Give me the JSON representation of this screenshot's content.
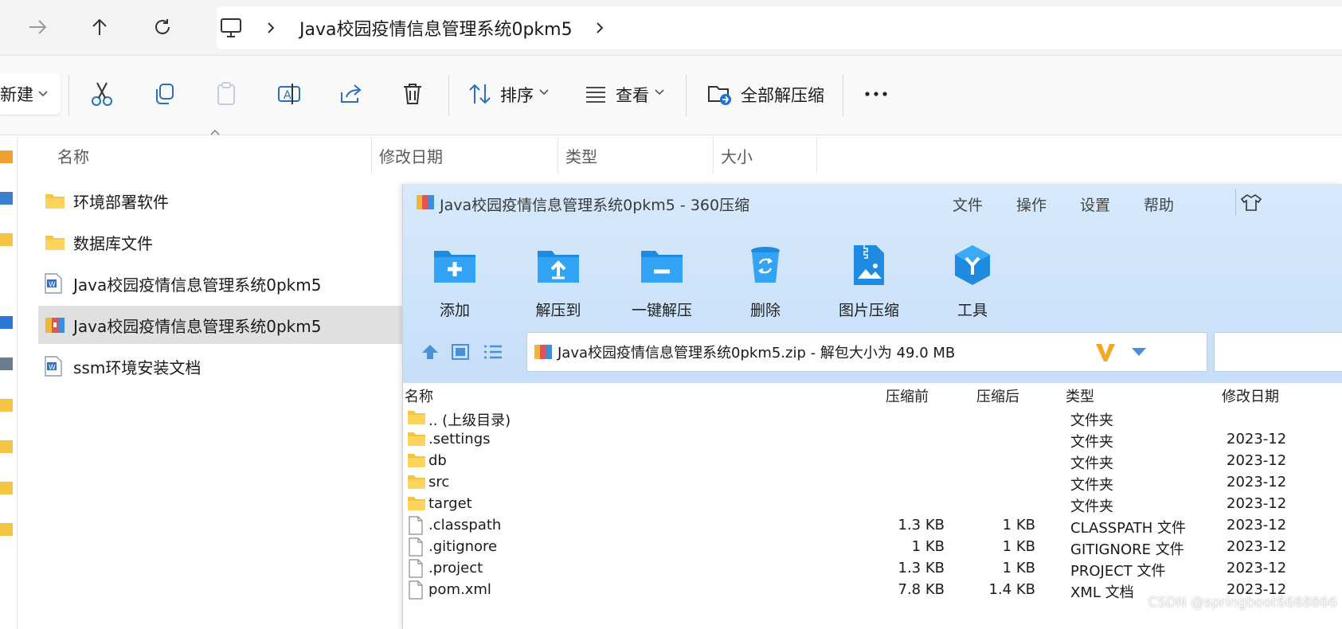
{
  "explorer": {
    "breadcrumb": [
      "Java校园疫情信息管理系统0pkm5"
    ],
    "commands": {
      "new_label": "新建",
      "sort_label": "排序",
      "view_label": "查看",
      "extract_all_label": "全部解压缩"
    },
    "columns": {
      "name": "名称",
      "modified": "修改日期",
      "type": "类型",
      "size": "大小"
    },
    "files": [
      {
        "name": "环境部署软件",
        "icon": "folder-icon"
      },
      {
        "name": "数据库文件",
        "icon": "folder-icon"
      },
      {
        "name": "Java校园疫情信息管理系统0pkm5",
        "icon": "word-doc-icon"
      },
      {
        "name": "Java校园疫情信息管理系统0pkm5",
        "icon": "zip-archive-icon",
        "selected": true
      },
      {
        "name": "ssm环境安装文档",
        "icon": "word-doc-icon"
      }
    ]
  },
  "zip": {
    "title": "Java校园疫情信息管理系统0pkm5 - 360压缩",
    "menu": [
      "文件",
      "操作",
      "设置",
      "帮助"
    ],
    "tools": [
      {
        "label": "添加",
        "icon": "add-folder-icon"
      },
      {
        "label": "解压到",
        "icon": "extract-to-icon"
      },
      {
        "label": "一键解压",
        "icon": "one-click-extract-icon"
      },
      {
        "label": "删除",
        "icon": "recycle-bin-icon"
      },
      {
        "label": "图片压缩",
        "icon": "image-compress-icon"
      },
      {
        "label": "工具",
        "icon": "tools-cube-icon"
      }
    ],
    "address": "Java校园疫情信息管理系统0pkm5.zip - 解包大小为 49.0 MB",
    "columns": {
      "name": "名称",
      "before": "压缩前",
      "after": "压缩后",
      "type": "类型",
      "modified": "修改日期"
    },
    "rows": [
      {
        "name": ".. (上级目录)",
        "before": "",
        "after": "",
        "type": "文件夹",
        "modified": "",
        "icon": "folder-icon"
      },
      {
        "name": ".settings",
        "before": "",
        "after": "",
        "type": "文件夹",
        "modified": "2023-12",
        "icon": "folder-icon"
      },
      {
        "name": "db",
        "before": "",
        "after": "",
        "type": "文件夹",
        "modified": "2023-12",
        "icon": "folder-icon"
      },
      {
        "name": "src",
        "before": "",
        "after": "",
        "type": "文件夹",
        "modified": "2023-12",
        "icon": "folder-icon"
      },
      {
        "name": "target",
        "before": "",
        "after": "",
        "type": "文件夹",
        "modified": "2023-12",
        "icon": "folder-icon"
      },
      {
        "name": ".classpath",
        "before": "1.3 KB",
        "after": "1 KB",
        "type": "CLASSPATH 文件",
        "modified": "2023-12",
        "icon": "file-icon"
      },
      {
        "name": ".gitignore",
        "before": "1 KB",
        "after": "1 KB",
        "type": "GITIGNORE 文件",
        "modified": "2023-12",
        "icon": "file-icon"
      },
      {
        "name": ".project",
        "before": "1.3 KB",
        "after": "1 KB",
        "type": "PROJECT 文件",
        "modified": "2023-12",
        "icon": "file-icon"
      },
      {
        "name": "pom.xml",
        "before": "7.8 KB",
        "after": "1.4 KB",
        "type": "XML 文档",
        "modified": "2023-12",
        "icon": "file-icon"
      }
    ],
    "watermark": "CSDN @springboot6688866"
  },
  "colors": {
    "zip_bg": "#cfe4fa",
    "accent_blue": "#1f8be0",
    "folder_yellow": "#f5c443",
    "selection": "#e0e0e0"
  }
}
